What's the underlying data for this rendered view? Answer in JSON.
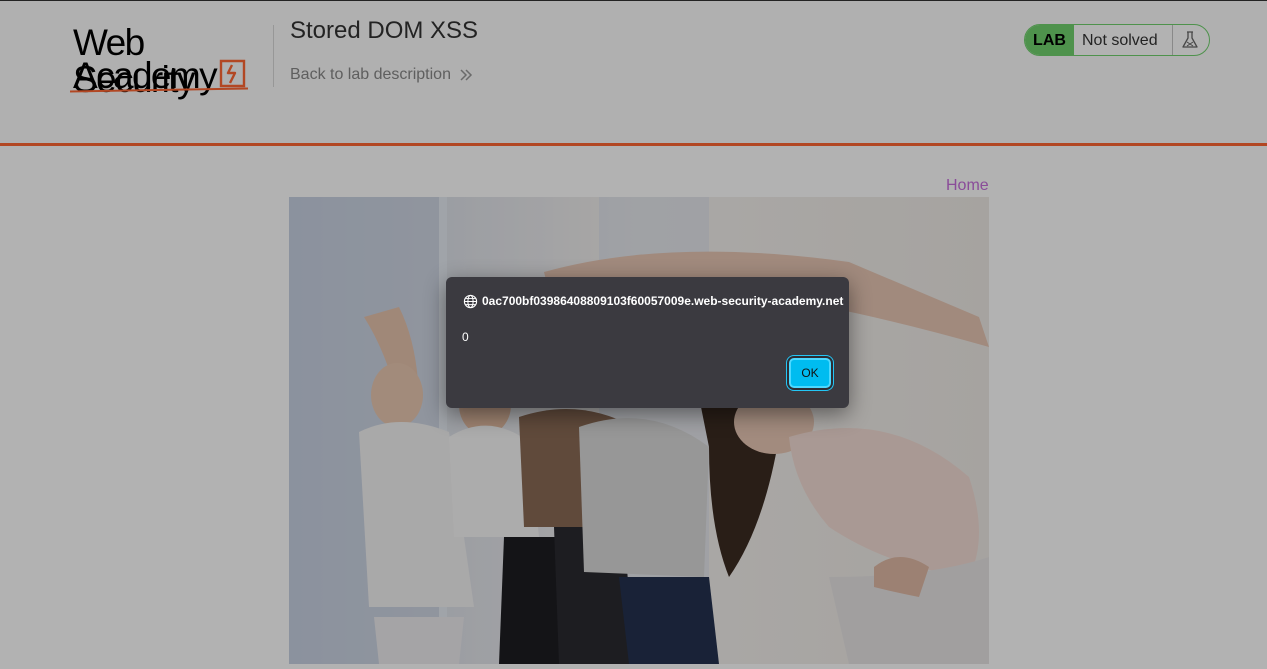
{
  "header": {
    "logo_line1": "Web Security",
    "logo_line2": "Academy",
    "lab_title": "Stored DOM XSS",
    "back_link": "Back to lab description",
    "status_badge": "LAB",
    "status_text": "Not solved"
  },
  "nav": {
    "home": "Home"
  },
  "dialog": {
    "origin": "0ac700bf03986408809103f60057009e.web-security-academy.net",
    "message": "0",
    "ok_label": "OK"
  },
  "colors": {
    "accent_orange": "#ff6633",
    "lab_green": "#70d16d",
    "link_purple": "#c66ddc",
    "dialog_bg": "#3b3a40",
    "ok_button": "#00bcf0"
  },
  "icons": [
    "globe-icon",
    "flask-icon",
    "double-chevron-right-icon",
    "academy-logo-mark"
  ]
}
